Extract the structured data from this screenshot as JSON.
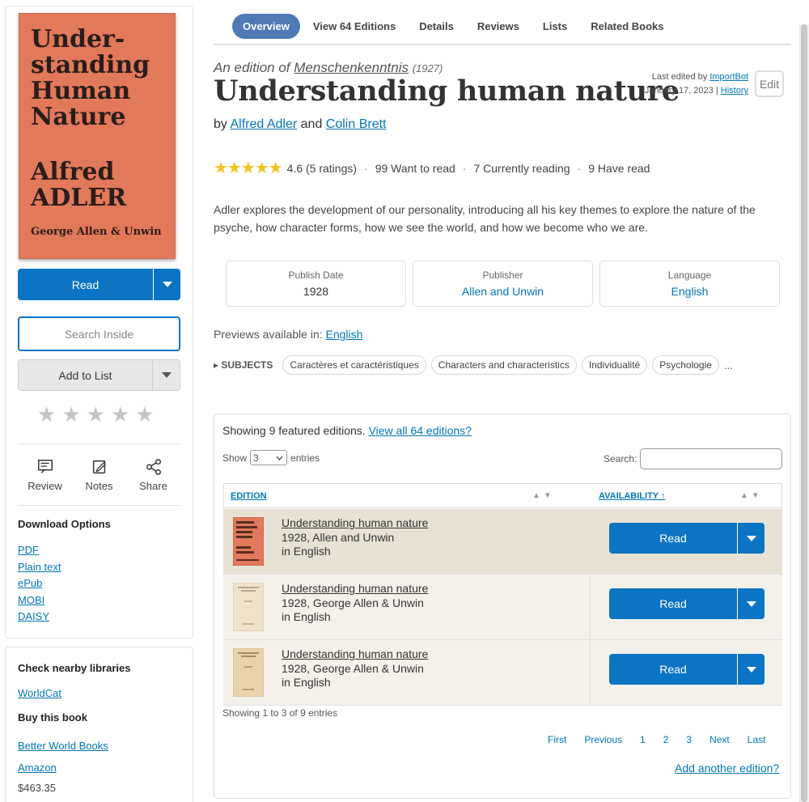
{
  "cover": {
    "title_lines": [
      "Under-",
      "standing",
      "Human",
      "Nature"
    ],
    "author_lines": [
      "Alfred",
      "ADLER"
    ],
    "publisher": "George Allen & Unwin"
  },
  "sidebar": {
    "read_label": "Read",
    "search_inside_placeholder": "Search Inside",
    "add_to_list_label": "Add to List",
    "actions": [
      {
        "label": "Review",
        "icon": "review-icon"
      },
      {
        "label": "Notes",
        "icon": "notes-icon"
      },
      {
        "label": "Share",
        "icon": "share-icon"
      }
    ],
    "download_title": "Download Options",
    "downloads": [
      "PDF",
      "Plain text",
      "ePub",
      "MOBI",
      "DAISY"
    ],
    "nearby_title": "Check nearby libraries",
    "nearby_link": "WorldCat",
    "buy_title": "Buy this book",
    "buy_links": [
      "Better World Books",
      "Amazon"
    ],
    "price": "$463.35"
  },
  "tabs": [
    "Overview",
    "View 64 Editions",
    "Details",
    "Reviews",
    "Lists",
    "Related Books"
  ],
  "header": {
    "edition_of_prefix": "An edition of",
    "work_title": "Menschenkenntnis",
    "work_year": "(1927)",
    "title": "Understanding human nature",
    "by": "by",
    "author1": "Alfred Adler",
    "and": "and",
    "author2": "Colin Brett",
    "last_edited_by": "Last edited by",
    "editor": "ImportBot",
    "edited_date": "January 17, 2023",
    "separator": "|",
    "history": "History",
    "edit_label": "Edit"
  },
  "stats": {
    "stars": "★★★★★",
    "rating": "4.6 (5 ratings)",
    "want": "99 Want to read",
    "reading": "7 Currently reading",
    "have": "9 Have read",
    "dot": "·"
  },
  "description": "Adler explores the development of our personality, introducing all his key themes to explore the nature of the psyche, how character forms, how we see the world, and how we become who we are.",
  "meta": {
    "publish_date_label": "Publish Date",
    "publish_date": "1928",
    "publisher_label": "Publisher",
    "publisher": "Allen and Unwin",
    "language_label": "Language",
    "language": "English"
  },
  "previews": {
    "label": "Previews available in:",
    "language": "English"
  },
  "subjects": {
    "label": "SUBJECTS",
    "items": [
      "Caractères et caractéristiques",
      "Characters and characteristics",
      "Individualité",
      "Psychologie"
    ],
    "more": "..."
  },
  "editions": {
    "showing": "Showing 9 featured editions.",
    "view_all": "View all 64 editions?",
    "show": "Show",
    "show_value": "3",
    "entries": "entries",
    "search_label": "Search:",
    "col_edition": "EDITION",
    "col_availability": "AVAILABILITY ↑",
    "sort_arrows": "▲▼",
    "rows": [
      {
        "title": "Understanding human nature",
        "line2": "1928, Allen and Unwin",
        "line3": "in English",
        "action": "Read"
      },
      {
        "title": "Understanding human nature",
        "line2": "1928, George Allen & Unwin",
        "line3": "in English",
        "action": "Read"
      },
      {
        "title": "Understanding human nature",
        "line2": "1928, George Allen & Unwin",
        "line3": "in English",
        "action": "Read"
      }
    ],
    "entries_info": "Showing 1 to 3 of 9 entries",
    "pager": [
      "First",
      "Previous",
      "1",
      "2",
      "3",
      "Next",
      "Last"
    ],
    "add_another": "Add another edition?"
  },
  "colors": {
    "accent": "#0b74c4",
    "tab_active": "#4f7ab5",
    "link": "#0376b8",
    "cover": "#e2795a",
    "star": "#f0c419"
  }
}
